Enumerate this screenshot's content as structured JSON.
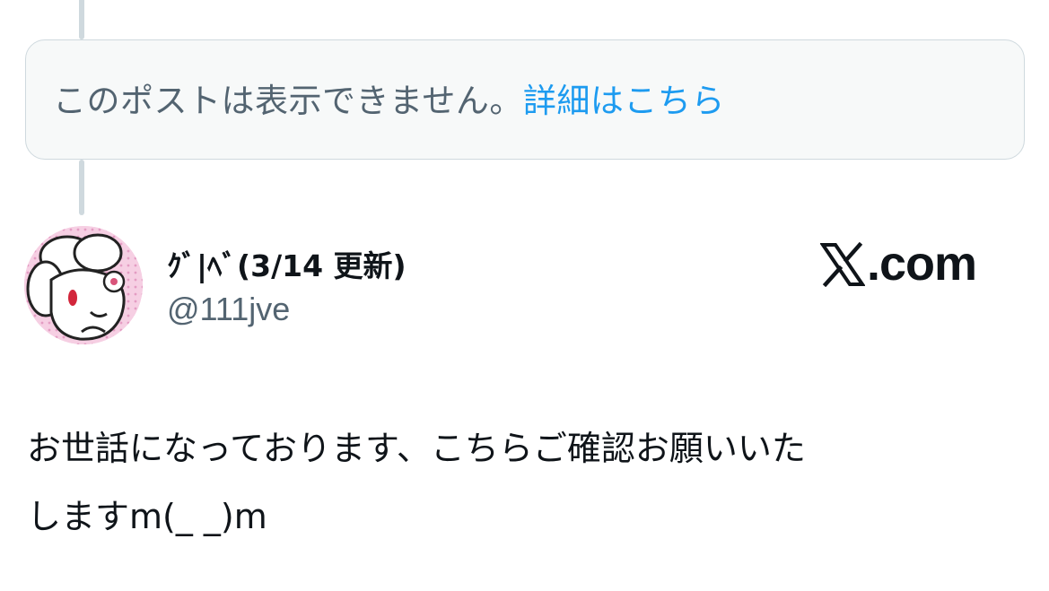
{
  "unavailable_notice": {
    "text": "このポストは表示できません。",
    "link_label": "詳細はこちら"
  },
  "author": {
    "display_name": "ｸﾞ|ﾍﾞ(3/14 更新)",
    "handle": "@111jve",
    "avatar_icon": "avatar-icon"
  },
  "source": {
    "label": ".com",
    "logo_icon": "x-logo-icon"
  },
  "post": {
    "lines": [
      "お世話になっております、こちらご確認お願いいた",
      "しますm(_ _)m"
    ]
  },
  "colors": {
    "link": "#1d9bf0",
    "secondary_text": "#536471",
    "border": "#cfd9de",
    "box_background": "#f7f9f9"
  }
}
